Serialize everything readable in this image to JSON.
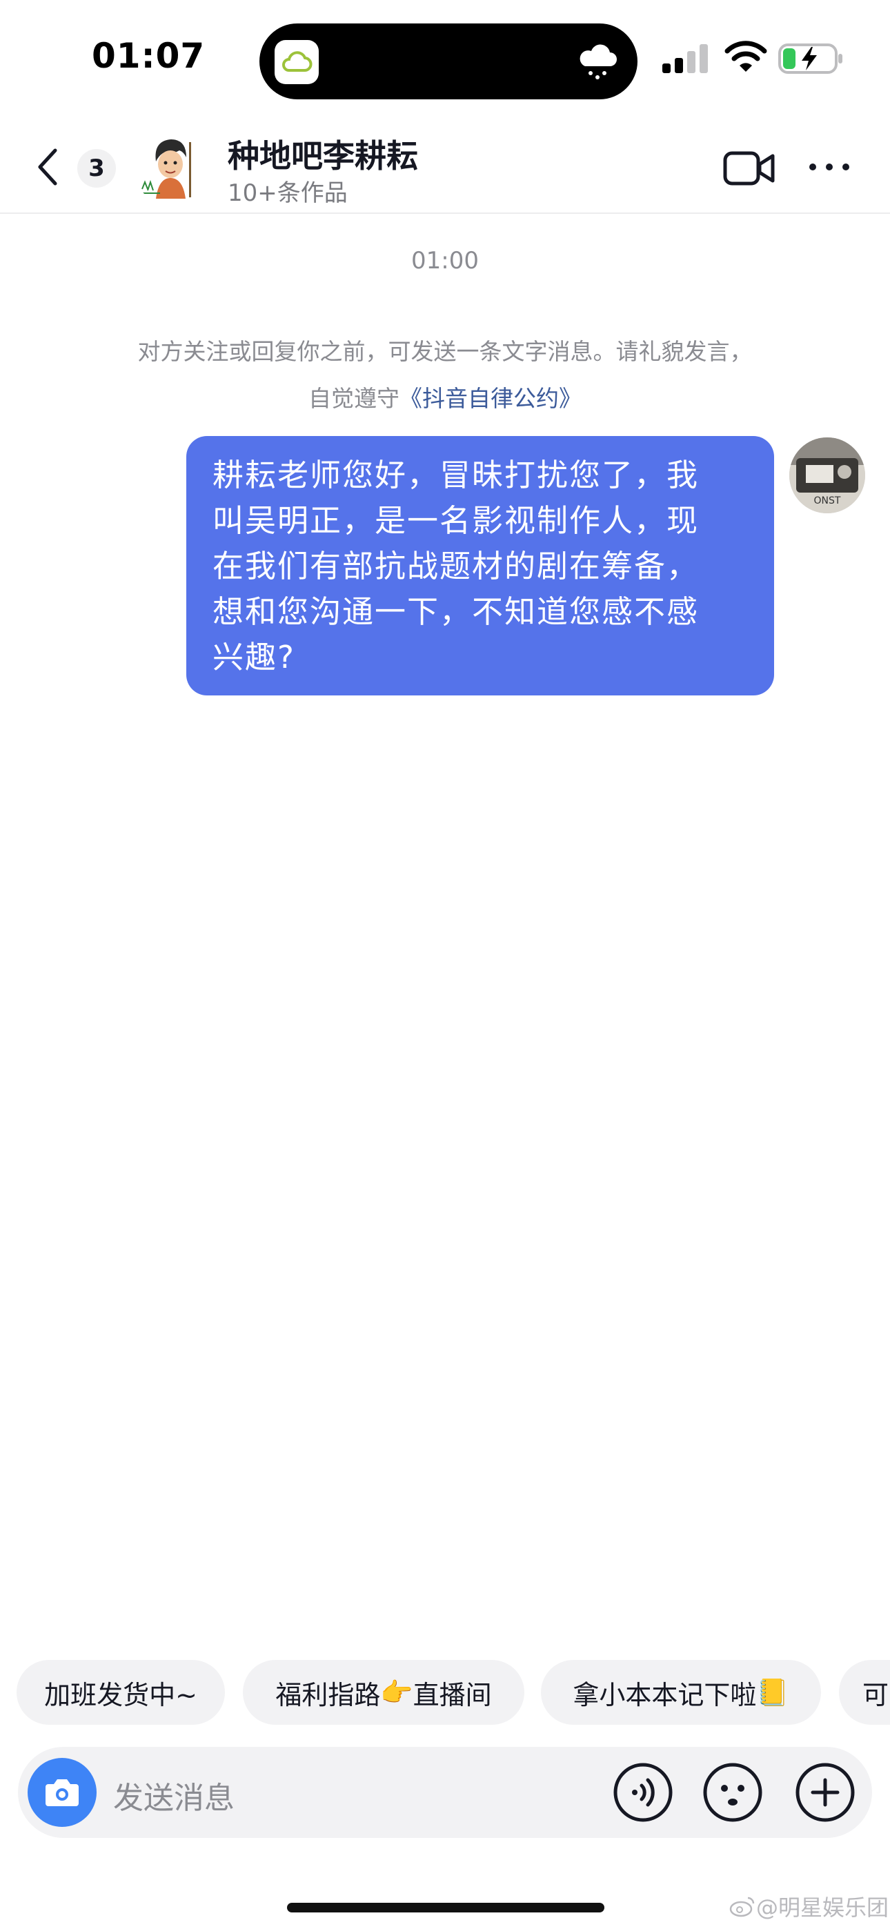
{
  "status_bar": {
    "time": "01:07",
    "icons": [
      "cloud-app-icon",
      "rain-weather-icon",
      "cellular-signal-icon",
      "wifi-icon",
      "battery-charging-icon"
    ]
  },
  "header": {
    "back_icon": "chevron-left-icon",
    "unread_count": "3",
    "contact_name": "种地吧李耕耘",
    "contact_subtitle": "10+条作品",
    "video_icon": "video-camera-icon",
    "more_icon": "more-dots-icon"
  },
  "chat": {
    "timestamp": "01:00",
    "notice_line1": "对方关注或回复你之前，可发送一条文字消息。请礼貌发言，",
    "notice_prefix": "自觉遵守",
    "notice_link": "《抖音自律公约》",
    "messages": [
      {
        "from": "me",
        "lines": [
          "耕耘老师您好，冒昧打扰您了，我",
          "叫吴明正，是一名影视制作人，现",
          "在我们有部抗战题材的剧在筹备，",
          "想和您沟通一下，不知道您感不感",
          "兴趣?"
        ]
      }
    ]
  },
  "quick_replies": [
    {
      "label": "加班发货中~"
    },
    {
      "label": "福利指路",
      "suffix": "直播间",
      "emoji": "👉"
    },
    {
      "label": "拿小本本记下啦",
      "emoji": "📒"
    },
    {
      "label": "可"
    }
  ],
  "input": {
    "placeholder": "发送消息",
    "camera_icon": "camera-icon",
    "voice_icon": "voice-icon",
    "emoji_icon": "emoji-face-icon",
    "plus_icon": "plus-circle-icon"
  },
  "watermark": "@明星娱乐团",
  "colors": {
    "bubble": "#5573ea",
    "camera_button": "#3e84f6",
    "link": "#3b5a9a",
    "muted_text": "#8a8b91",
    "chip_bg": "#f2f2f4"
  }
}
